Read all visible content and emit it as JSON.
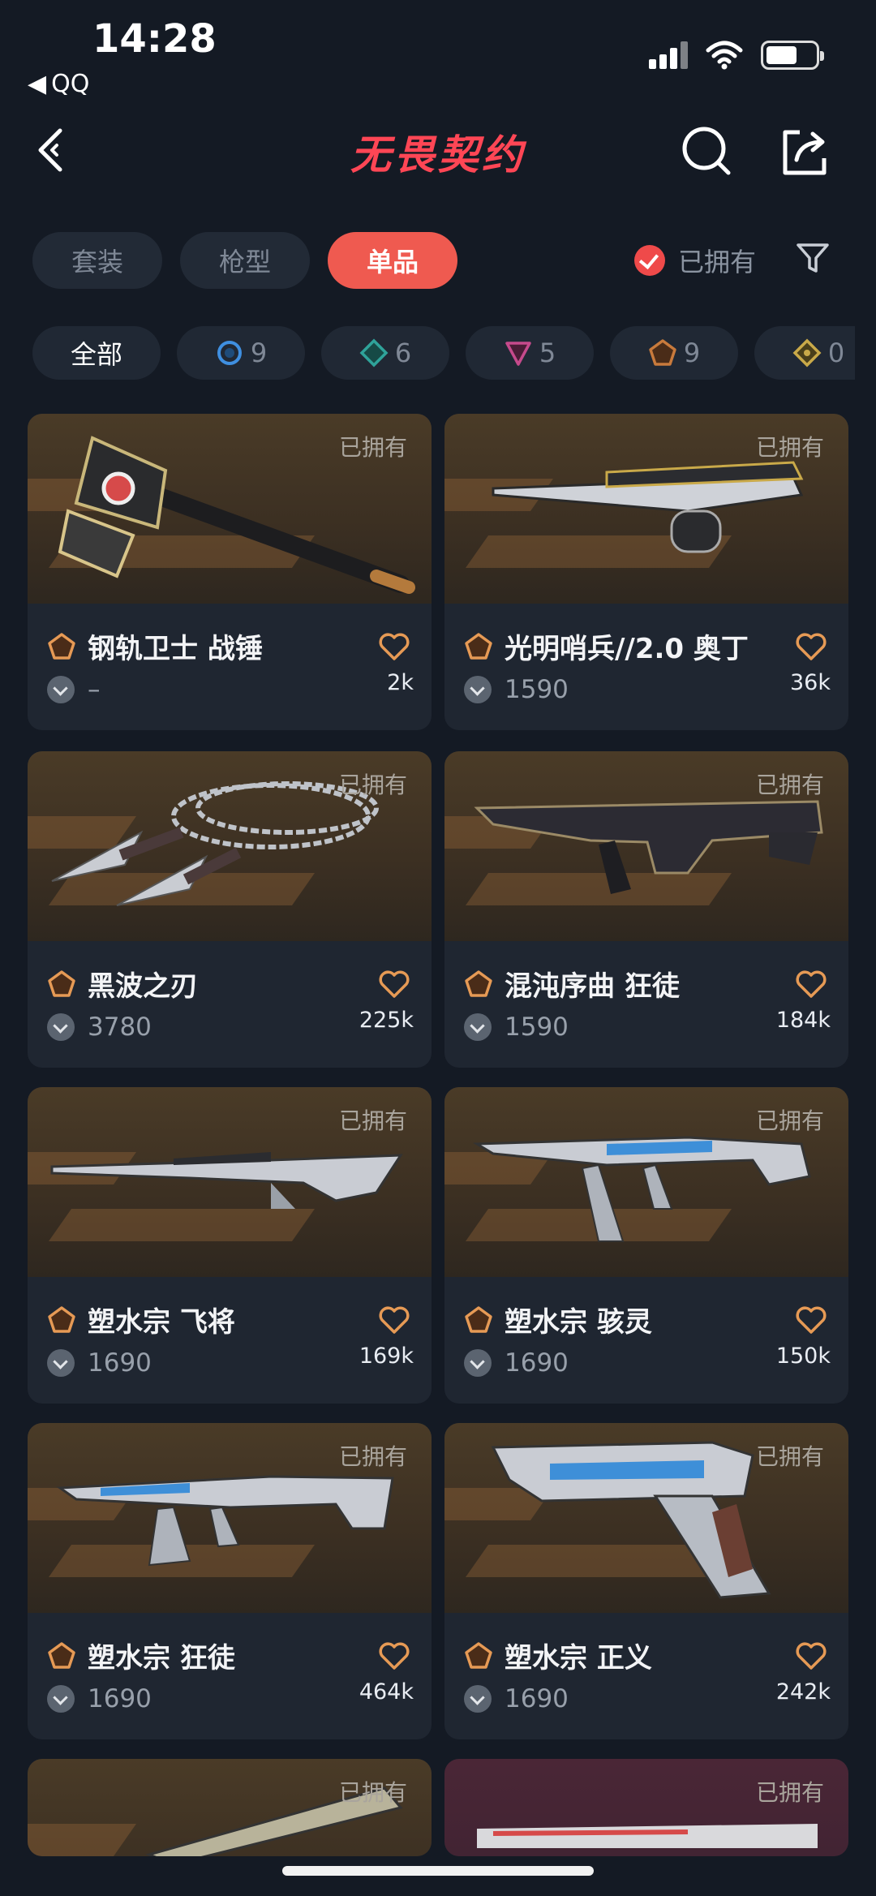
{
  "status_bar": {
    "time": "14:28",
    "back_app": "QQ"
  },
  "nav": {
    "logo_text": "无畏契约"
  },
  "tabs": [
    {
      "label": "套装",
      "active": false
    },
    {
      "label": "枪型",
      "active": false
    },
    {
      "label": "单品",
      "active": true
    }
  ],
  "owned_filter": {
    "label": "已拥有",
    "checked": true
  },
  "chips": [
    {
      "label": "全部"
    },
    {
      "count": "9",
      "color": "#3f8fe0",
      "shape": "circle"
    },
    {
      "count": "6",
      "color": "#2fa39a",
      "shape": "diamond"
    },
    {
      "count": "5",
      "color": "#c64a8c",
      "shape": "triangle"
    },
    {
      "count": "9",
      "color": "#c87a3c",
      "shape": "pentagon"
    },
    {
      "count": "0",
      "color": "#c9a949",
      "shape": "diamond"
    }
  ],
  "colors": {
    "accent": "#ef5a50",
    "tier_select": "#e69a55",
    "heart": "#e69a55"
  },
  "cards": [
    {
      "owned": "已拥有",
      "name": "钢轨卫士 战锤",
      "price": "–",
      "likes": "2k",
      "weapon": "hammer"
    },
    {
      "owned": "已拥有",
      "name": "光明哨兵//2.0 奥丁",
      "price": "1590",
      "likes": "36k",
      "weapon": "odin"
    },
    {
      "owned": "已拥有",
      "name": "黑波之刃",
      "price": "3780",
      "likes": "225k",
      "weapon": "kunai"
    },
    {
      "owned": "已拥有",
      "name": "混沌序曲 狂徒",
      "price": "1590",
      "likes": "184k",
      "weapon": "rifle"
    },
    {
      "owned": "已拥有",
      "name": "塑水宗 飞将",
      "price": "1690",
      "likes": "169k",
      "weapon": "sniper"
    },
    {
      "owned": "已拥有",
      "name": "塑水宗 骇灵",
      "price": "1690",
      "likes": "150k",
      "weapon": "smg"
    },
    {
      "owned": "已拥有",
      "name": "塑水宗 狂徒",
      "price": "1690",
      "likes": "464k",
      "weapon": "rifle2"
    },
    {
      "owned": "已拥有",
      "name": "塑水宗 正义",
      "price": "1690",
      "likes": "242k",
      "weapon": "pistol"
    },
    {
      "owned": "已拥有",
      "weapon": "knife"
    },
    {
      "owned": "已拥有",
      "weapon": "red-rifle"
    }
  ]
}
